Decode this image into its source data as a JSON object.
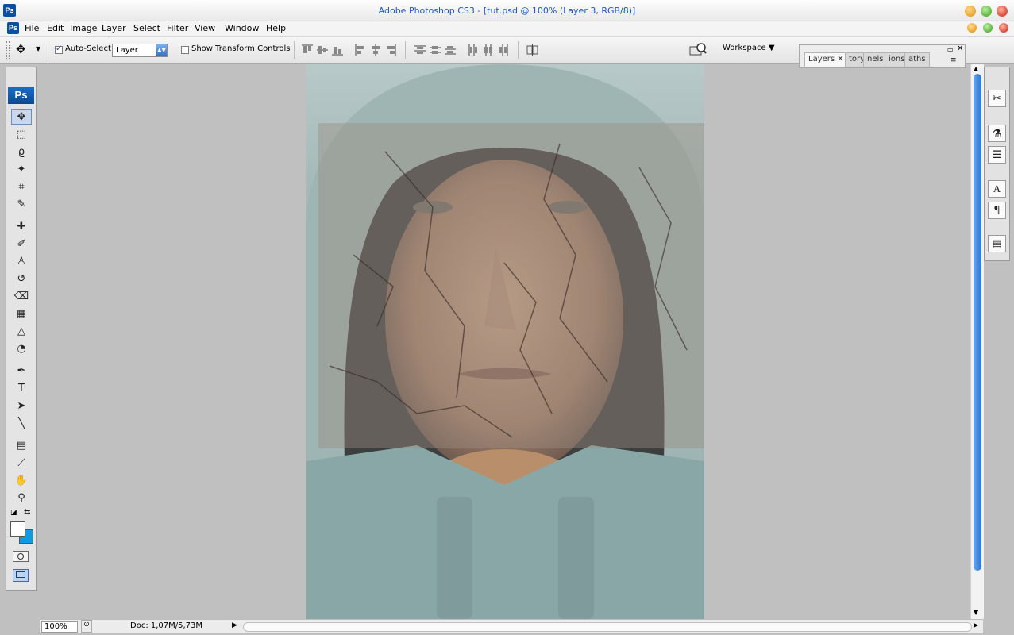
{
  "window": {
    "title": "Adobe Photoshop CS3 - [tut.psd @ 100% (Layer 3, RGB/8)]",
    "app_icon": "Ps"
  },
  "menu": {
    "items": [
      "File",
      "Edit",
      "Image",
      "Layer",
      "Select",
      "Filter",
      "View",
      "Window",
      "Help"
    ]
  },
  "options": {
    "auto_select_label": "Auto-Select:",
    "auto_select_checked": true,
    "auto_select_value": "Layer",
    "show_transform_label": "Show Transform Controls",
    "show_transform_checked": false,
    "workspace_label": "Workspace ▼"
  },
  "dock": {
    "tabs": [
      "Layers",
      "tory",
      "nels",
      "ions",
      "aths"
    ]
  },
  "toolbox": {
    "logo": "Ps",
    "tools": [
      {
        "name": "move-tool",
        "glyph": "✥",
        "selected": true
      },
      {
        "name": "marquee-tool",
        "glyph": "⬚"
      },
      {
        "name": "lasso-tool",
        "glyph": "ϱ"
      },
      {
        "name": "magic-wand-tool",
        "glyph": "✦"
      },
      {
        "name": "crop-tool",
        "glyph": "⌗"
      },
      {
        "name": "slice-tool",
        "glyph": "✎"
      },
      {
        "name": "healing-brush-tool",
        "glyph": "✚"
      },
      {
        "name": "brush-tool",
        "glyph": "✐"
      },
      {
        "name": "clone-stamp-tool",
        "glyph": "♙"
      },
      {
        "name": "history-brush-tool",
        "glyph": "↺"
      },
      {
        "name": "eraser-tool",
        "glyph": "⌫"
      },
      {
        "name": "gradient-tool",
        "glyph": "▦"
      },
      {
        "name": "blur-tool",
        "glyph": "△"
      },
      {
        "name": "dodge-tool",
        "glyph": "◔"
      },
      {
        "name": "pen-tool",
        "glyph": "✒"
      },
      {
        "name": "type-tool",
        "glyph": "T"
      },
      {
        "name": "path-selection-tool",
        "glyph": "➤"
      },
      {
        "name": "line-tool",
        "glyph": "╲"
      },
      {
        "name": "notes-tool",
        "glyph": "▤"
      },
      {
        "name": "eyedropper-tool",
        "glyph": "⟋"
      },
      {
        "name": "hand-tool",
        "glyph": "✋"
      },
      {
        "name": "zoom-tool",
        "glyph": "⚲"
      }
    ]
  },
  "rightstrip": {
    "tools": [
      {
        "name": "tools-icon",
        "glyph": "✂"
      },
      {
        "name": "clone-source-icon",
        "glyph": "⚗"
      },
      {
        "name": "tool-presets-icon",
        "glyph": "☰"
      },
      {
        "name": "character-icon",
        "glyph": "A"
      },
      {
        "name": "paragraph-icon",
        "glyph": "¶"
      },
      {
        "name": "layer-comps-icon",
        "glyph": "▤"
      }
    ]
  },
  "status": {
    "zoom": "100%",
    "doc": "Doc: 1,07M/5,73M"
  },
  "colors": {
    "accent": "#1f56c6",
    "background": "#c0c0c0",
    "foreground_swatch": "#ffffff",
    "background_swatch": "#0e9be0"
  }
}
